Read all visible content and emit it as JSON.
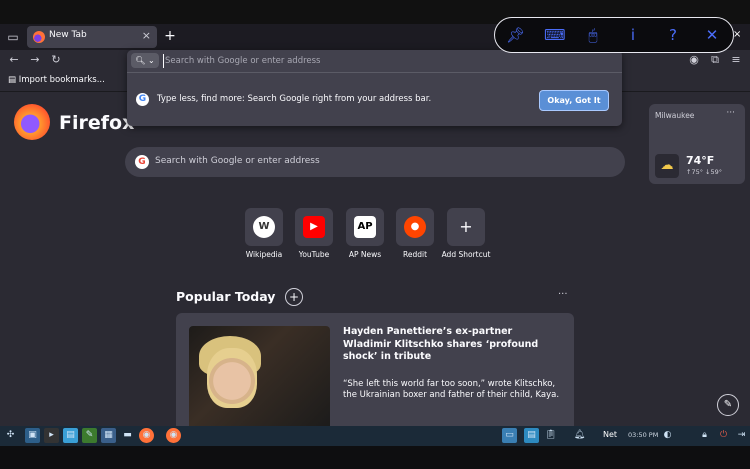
{
  "browser": {
    "tab_title": "New Tab",
    "bookmarks_item": "Import bookmarks...",
    "address_placeholder": "Search with Google or enter address",
    "tip_text": "Type less, find more: Search Google right from your address bar.",
    "tip_button": "Okay, Got It"
  },
  "newtab": {
    "brand": "Firefox",
    "search_placeholder": "Search with Google or enter address",
    "weather": {
      "city": "Milwaukee",
      "temp": "74°F",
      "hilo": "↑75°  ↓59°"
    },
    "shortcuts": [
      {
        "label": "Wikipedia",
        "icon": "wikipedia-icon",
        "glyph": "W",
        "bg": "#ffffff",
        "fg": "#333333"
      },
      {
        "label": "YouTube",
        "icon": "youtube-icon",
        "glyph": "▶",
        "bg": "#ff0000",
        "fg": "#ffffff"
      },
      {
        "label": "AP News",
        "icon": "ap-news-icon",
        "glyph": "AP",
        "bg": "#ffffff",
        "fg": "#000000"
      },
      {
        "label": "Reddit",
        "icon": "reddit-icon",
        "glyph": "👽",
        "bg": "#ff4500",
        "fg": "#ffffff"
      },
      {
        "label": "Add Shortcut",
        "icon": "plus-icon",
        "glyph": "+",
        "bg": "transparent",
        "fg": "#fbfbfe"
      }
    ],
    "popular_title": "Popular Today",
    "story": {
      "headline": "Hayden Panettiere’s ex-partner Wladimir Klitschko shares ‘profound shock’ in tribute",
      "excerpt": "“She left this world far too soon,” wrote Klitschko, the Ukrainian boxer and father of their child, Kaya."
    }
  },
  "taskbar": {
    "net": "Net",
    "clock": "03:50 PM"
  },
  "colors": {
    "accent": "#5a8fd6",
    "osk": "#4a6cf7",
    "panel": "#42414d",
    "background": "#2b2a33"
  }
}
